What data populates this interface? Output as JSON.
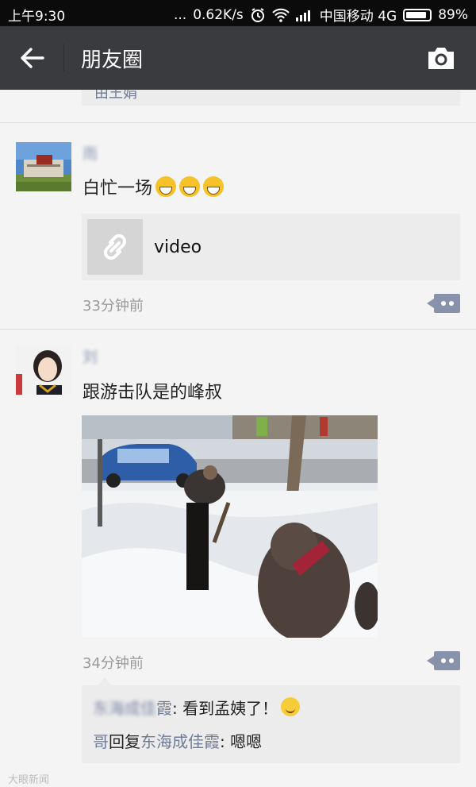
{
  "status_bar": {
    "time": "上午9:30",
    "dots": "...",
    "speed": "0.62K/s",
    "carrier": "中国移动 4G",
    "battery": "89%",
    "battery_level": 0.89
  },
  "header": {
    "title": "朋友圈"
  },
  "prev_post": {
    "stub_text": "由王娟"
  },
  "posts": [
    {
      "name": "雨",
      "text": "白忙一场",
      "link_label": "video",
      "time": "33分钟前"
    },
    {
      "name": "刘",
      "text": "跟游击队是的峰叔",
      "time": "34分钟前",
      "comments": [
        {
          "name": "霞",
          "text": ": 看到孟姨了！"
        },
        {
          "name": "哥",
          "reply_word": "回复",
          "reply_to": "东海成佳霞",
          "text": ": 嗯嗯"
        }
      ]
    }
  ],
  "watermark": "大眼新闻",
  "colors": {
    "header_bg": "#3a3b3f",
    "status_bg": "#0b0b0b",
    "nick_color": "#6d7c98",
    "more_btn": "#8893ab"
  }
}
